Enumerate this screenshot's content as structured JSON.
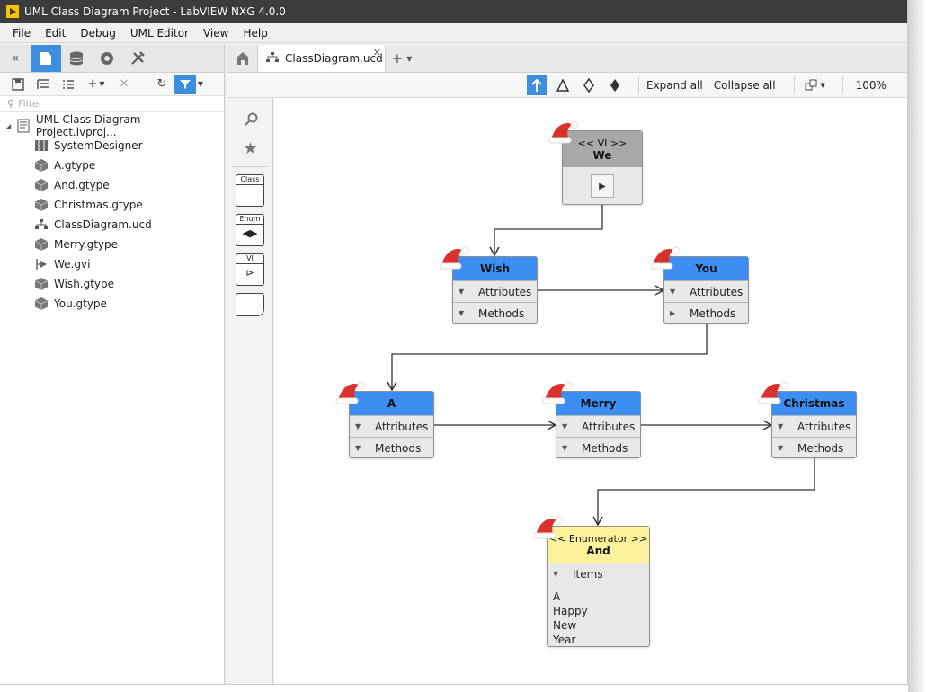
{
  "window": {
    "title": "UML Class Diagram Project - LabVIEW NXG 4.0.0"
  },
  "menu": [
    "File",
    "Edit",
    "Debug",
    "UML Editor",
    "View",
    "Help"
  ],
  "left_panel": {
    "filter_placeholder": "Filter",
    "tree": {
      "root": "UML Class Diagram Project.lvproj...",
      "items": [
        {
          "label": "SystemDesigner",
          "icon": "system-designer-icon"
        },
        {
          "label": "A.gtype",
          "icon": "gtype-icon"
        },
        {
          "label": "And.gtype",
          "icon": "gtype-icon"
        },
        {
          "label": "Christmas.gtype",
          "icon": "gtype-icon"
        },
        {
          "label": "ClassDiagram.ucd",
          "icon": "class-diagram-icon"
        },
        {
          "label": "Merry.gtype",
          "icon": "gtype-icon"
        },
        {
          "label": "We.gvi",
          "icon": "gvi-icon"
        },
        {
          "label": "Wish.gtype",
          "icon": "gtype-icon"
        },
        {
          "label": "You.gtype",
          "icon": "gtype-icon"
        }
      ]
    }
  },
  "doc_tab": {
    "label": "ClassDiagram.ucd"
  },
  "toolbar": {
    "expand_all": "Expand all",
    "collapse_all": "Collapse all",
    "zoom": "100%"
  },
  "palette": {
    "class_label": "Class",
    "enum_label": "Enum",
    "vi_label": "VI"
  },
  "diagram": {
    "we": {
      "stereotype": "<< VI >>",
      "name": "We"
    },
    "wish": {
      "name": "Wish",
      "attributes": "Attributes",
      "methods": "Methods"
    },
    "you": {
      "name": "You",
      "attributes": "Attributes",
      "methods": "Methods"
    },
    "a": {
      "name": "A",
      "attributes": "Attributes",
      "methods": "Methods"
    },
    "merry": {
      "name": "Merry",
      "attributes": "Attributes",
      "methods": "Methods"
    },
    "christmas": {
      "name": "Christmas",
      "attributes": "Attributes",
      "methods": "Methods"
    },
    "and": {
      "stereotype": "<< Enumerator >>",
      "name": "And",
      "items_label": "Items",
      "items": [
        "A",
        "Happy",
        "New",
        "Year"
      ]
    }
  },
  "colors": {
    "accent": "#3d8ede",
    "class_header": "#3d8ef3",
    "vi_header": "#a8a8a8",
    "enum_header": "#fdf39c",
    "titlebar": "#3c3c3c"
  }
}
